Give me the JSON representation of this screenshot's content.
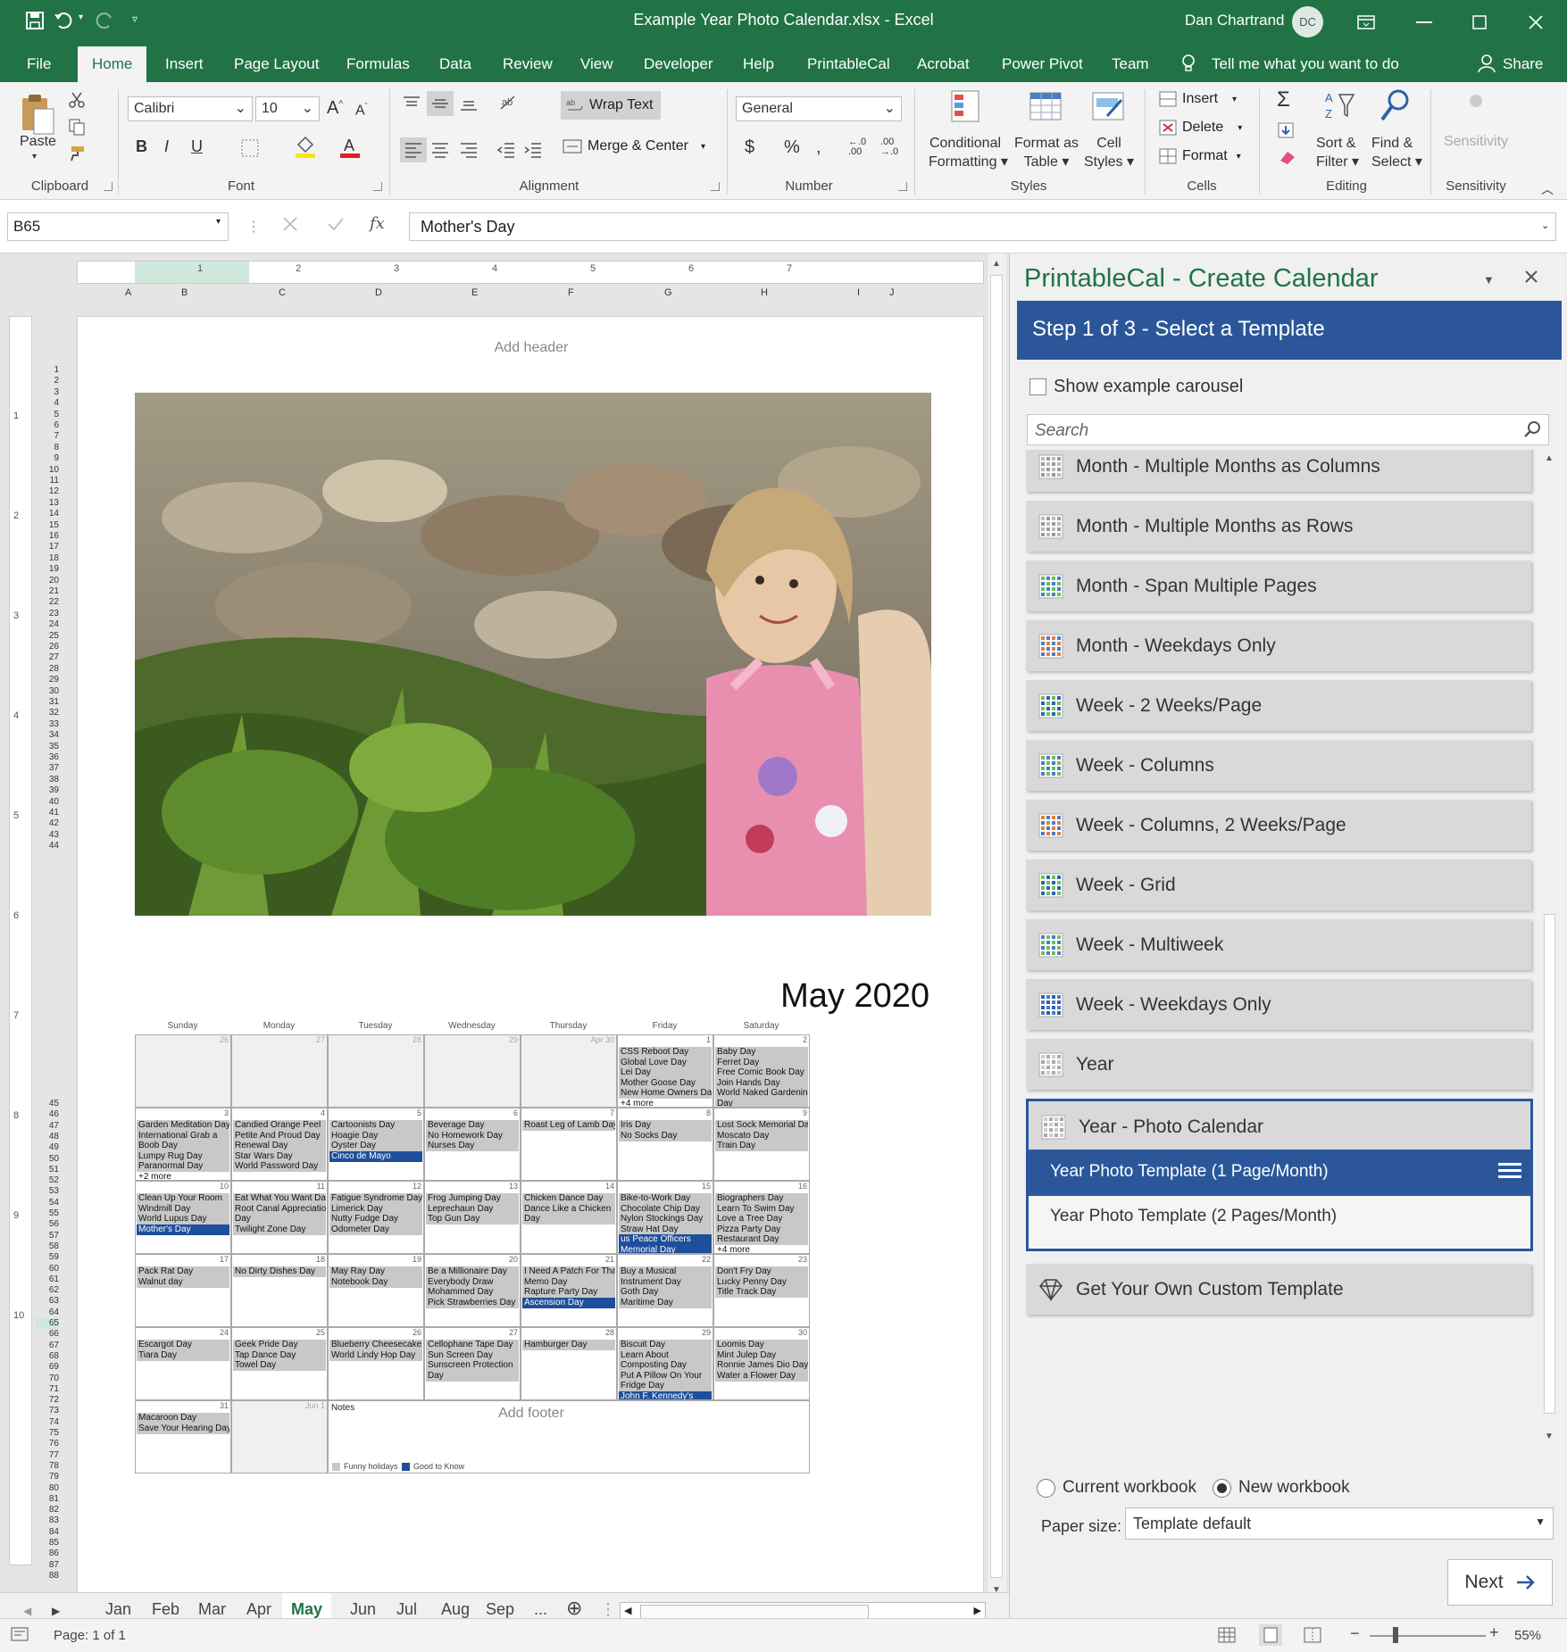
{
  "window": {
    "title": "Example Year Photo Calendar.xlsx  -  Excel",
    "user": "Dan Chartrand",
    "user_initials": "DC"
  },
  "menu": {
    "tabs": [
      "File",
      "Home",
      "Insert",
      "Page Layout",
      "Formulas",
      "Data",
      "Review",
      "View",
      "Developer",
      "Help",
      "PrintableCal",
      "Acrobat",
      "Power Pivot",
      "Team"
    ],
    "tell_me": "Tell me what you want to do",
    "share": "Share"
  },
  "ribbon": {
    "clipboard": {
      "paste": "Paste",
      "label": "Clipboard"
    },
    "font": {
      "name": "Calibri",
      "size": "10",
      "label": "Font"
    },
    "alignment": {
      "wrap": "Wrap Text",
      "merge": "Merge & Center",
      "label": "Alignment"
    },
    "number": {
      "format": "General",
      "label": "Number"
    },
    "styles": {
      "conditional": [
        "Conditional",
        "Formatting"
      ],
      "format_table": [
        "Format as",
        "Table"
      ],
      "cell_styles": [
        "Cell",
        "Styles"
      ],
      "label": "Styles"
    },
    "cells": {
      "insert": "Insert",
      "delete": "Delete",
      "format": "Format",
      "label": "Cells"
    },
    "editing": {
      "sort": [
        "Sort &",
        "Filter"
      ],
      "find": [
        "Find &",
        "Select"
      ],
      "label": "Editing"
    },
    "sensitivity": {
      "button": "Sensitivity",
      "label": "Sensitivity"
    }
  },
  "formula_bar": {
    "name_box": "B65",
    "value": "Mother's Day"
  },
  "sheet": {
    "ruler_marks": [
      "1",
      "2",
      "3",
      "4",
      "5",
      "6",
      "7"
    ],
    "columns": [
      "A",
      "B",
      "C",
      "D",
      "E",
      "F",
      "G",
      "H",
      "I",
      "J"
    ],
    "vruler_marks": [
      "1",
      "2",
      "3",
      "4",
      "5",
      "6",
      "7",
      "8",
      "9",
      "10"
    ],
    "add_header": "Add header",
    "add_footer": "Add footer",
    "month_title": "May 2020",
    "day_names": [
      "Sunday",
      "Monday",
      "Tuesday",
      "Wednesday",
      "Thursday",
      "Friday",
      "Saturday"
    ],
    "weeks": [
      [
        {
          "day": "26",
          "dim": true,
          "grey": true,
          "events": []
        },
        {
          "day": "27",
          "dim": true,
          "grey": true,
          "events": []
        },
        {
          "day": "28",
          "dim": true,
          "grey": true,
          "events": []
        },
        {
          "day": "29",
          "dim": true,
          "grey": true,
          "events": []
        },
        {
          "day": "Apr 30",
          "dim": true,
          "grey": true,
          "events": []
        },
        {
          "day": "1",
          "events": [
            {
              "t": "CSS Reboot Day"
            },
            {
              "t": "Global Love Day"
            },
            {
              "t": "Lei Day"
            },
            {
              "t": "Mother Goose Day"
            },
            {
              "t": "New Home Owners Day"
            },
            {
              "t": "+4 more",
              "k": "plain"
            }
          ]
        },
        {
          "day": "2",
          "events": [
            {
              "t": "Baby Day"
            },
            {
              "t": "Ferret Day"
            },
            {
              "t": "Free Comic Book Day"
            },
            {
              "t": "Join Hands Day"
            },
            {
              "t": "World Naked Gardening"
            },
            {
              "t": "Day"
            }
          ]
        }
      ],
      [
        {
          "day": "3",
          "events": [
            {
              "t": "Garden Meditation Day"
            },
            {
              "t": "International Grab a"
            },
            {
              "t": "Boob Day"
            },
            {
              "t": "Lumpy Rug Day"
            },
            {
              "t": "Paranormal Day"
            },
            {
              "t": "+2 more",
              "k": "plain"
            }
          ]
        },
        {
          "day": "4",
          "events": [
            {
              "t": "Candied Orange Peel"
            },
            {
              "t": "Petite And Proud Day"
            },
            {
              "t": "Renewal Day"
            },
            {
              "t": "Star Wars Day"
            },
            {
              "t": "World Password Day"
            }
          ]
        },
        {
          "day": "5",
          "events": [
            {
              "t": "Cartoonists Day"
            },
            {
              "t": "Hoagie Day"
            },
            {
              "t": "Oyster Day"
            },
            {
              "t": "Cinco de Mayo",
              "k": "blue"
            }
          ]
        },
        {
          "day": "6",
          "events": [
            {
              "t": "Beverage Day"
            },
            {
              "t": "No Homework Day"
            },
            {
              "t": "Nurses Day"
            }
          ]
        },
        {
          "day": "7",
          "events": [
            {
              "t": "Roast Leg of Lamb Day"
            }
          ]
        },
        {
          "day": "8",
          "events": [
            {
              "t": "Iris Day"
            },
            {
              "t": "No Socks Day"
            }
          ]
        },
        {
          "day": "9",
          "events": [
            {
              "t": "Lost Sock Memorial Day"
            },
            {
              "t": "Moscato Day"
            },
            {
              "t": "Train Day"
            }
          ]
        }
      ],
      [
        {
          "day": "10",
          "events": [
            {
              "t": "Clean Up Your Room"
            },
            {
              "t": "Windmill Day"
            },
            {
              "t": "World Lupus Day"
            },
            {
              "t": "Mother's Day",
              "k": "blue"
            }
          ]
        },
        {
          "day": "11",
          "events": [
            {
              "t": "Eat What You Want Day"
            },
            {
              "t": "Root Canal Appreciation"
            },
            {
              "t": "Day"
            },
            {
              "t": "Twilight Zone Day"
            }
          ]
        },
        {
          "day": "12",
          "events": [
            {
              "t": "Fatigue Syndrome Day"
            },
            {
              "t": "Limerick Day"
            },
            {
              "t": "Nutty Fudge Day"
            },
            {
              "t": "Odometer Day"
            }
          ]
        },
        {
          "day": "13",
          "events": [
            {
              "t": "Frog Jumping Day"
            },
            {
              "t": "Leprechaun Day"
            },
            {
              "t": "Top Gun Day"
            }
          ]
        },
        {
          "day": "14",
          "events": [
            {
              "t": "Chicken Dance Day"
            },
            {
              "t": "Dance Like a Chicken"
            },
            {
              "t": "Day"
            }
          ]
        },
        {
          "day": "15",
          "events": [
            {
              "t": "Bike-to-Work Day"
            },
            {
              "t": "Chocolate Chip Day"
            },
            {
              "t": "Nylon Stockings Day"
            },
            {
              "t": "Straw Hat Day"
            },
            {
              "t": "us Peace Officers",
              "k": "blue"
            },
            {
              "t": "Memorial Day",
              "k": "blue"
            }
          ]
        },
        {
          "day": "16",
          "events": [
            {
              "t": "Biographers Day"
            },
            {
              "t": "Learn To Swim Day"
            },
            {
              "t": "Love a Tree Day"
            },
            {
              "t": "Pizza Party Day"
            },
            {
              "t": "Restaurant Day"
            },
            {
              "t": "+4 more",
              "k": "plain"
            }
          ]
        }
      ],
      [
        {
          "day": "17",
          "events": [
            {
              "t": "Pack Rat Day"
            },
            {
              "t": "Walnut day"
            }
          ]
        },
        {
          "day": "18",
          "events": [
            {
              "t": "No Dirty Dishes Day"
            }
          ]
        },
        {
          "day": "19",
          "events": [
            {
              "t": "May Ray Day"
            },
            {
              "t": "Notebook Day"
            }
          ]
        },
        {
          "day": "20",
          "events": [
            {
              "t": "Be a Millionaire Day"
            },
            {
              "t": "Everybody Draw"
            },
            {
              "t": "Mohammed Day"
            },
            {
              "t": "Pick Strawberries Day"
            }
          ]
        },
        {
          "day": "21",
          "events": [
            {
              "t": "I Need A Patch For That"
            },
            {
              "t": "Memo Day"
            },
            {
              "t": "Rapture Party Day"
            },
            {
              "t": "Ascension Day",
              "k": "blue"
            }
          ]
        },
        {
          "day": "22",
          "events": [
            {
              "t": "Buy a Musical"
            },
            {
              "t": "Instrument Day"
            },
            {
              "t": "Goth Day"
            },
            {
              "t": "Maritime Day"
            }
          ]
        },
        {
          "day": "23",
          "events": [
            {
              "t": "Don't Fry Day"
            },
            {
              "t": "Lucky Penny Day"
            },
            {
              "t": "Title Track Day"
            }
          ]
        }
      ],
      [
        {
          "day": "24",
          "events": [
            {
              "t": "Escargot Day"
            },
            {
              "t": "Tiara Day"
            }
          ]
        },
        {
          "day": "25",
          "events": [
            {
              "t": "Geek Pride Day"
            },
            {
              "t": "Tap Dance Day"
            },
            {
              "t": "Towel Day"
            }
          ]
        },
        {
          "day": "26",
          "events": [
            {
              "t": "Blueberry Cheesecake"
            },
            {
              "t": "World Lindy Hop Day"
            }
          ]
        },
        {
          "day": "27",
          "events": [
            {
              "t": "Cellophane Tape Day"
            },
            {
              "t": "Sun Screen Day"
            },
            {
              "t": "Sunscreen Protection"
            },
            {
              "t": "Day"
            }
          ]
        },
        {
          "day": "28",
          "events": [
            {
              "t": "Hamburger Day"
            }
          ]
        },
        {
          "day": "29",
          "events": [
            {
              "t": "Biscuit Day"
            },
            {
              "t": "Learn About"
            },
            {
              "t": "Composting Day"
            },
            {
              "t": "Put A Pillow On Your"
            },
            {
              "t": "Fridge Day"
            },
            {
              "t": "John F. Kennedy's",
              "k": "blue"
            }
          ]
        },
        {
          "day": "30",
          "events": [
            {
              "t": "Loomis Day"
            },
            {
              "t": "Mint Julep Day"
            },
            {
              "t": "Ronnie James Dio Day"
            },
            {
              "t": "Water a Flower Day"
            }
          ]
        }
      ]
    ],
    "last_row": [
      {
        "day": "31",
        "events": [
          {
            "t": "Macaroon Day"
          },
          {
            "t": "Save Your Hearing Day"
          }
        ]
      },
      {
        "day": "Jun 1",
        "dim": true,
        "grey": true,
        "events": []
      }
    ],
    "notes_label": "Notes",
    "legend": [
      {
        "label": "Funny holidays",
        "color": "#c8c8c8"
      },
      {
        "label": "Good to Know",
        "color": "#1e4f9a"
      }
    ],
    "tabs": [
      "Jan",
      "Feb",
      "Mar",
      "Apr",
      "May",
      "Jun",
      "Jul",
      "Aug",
      "Sep",
      "..."
    ],
    "active_tab": "May"
  },
  "pane": {
    "title": "PrintableCal - Create Calendar",
    "step": "Step 1 of 3 - Select a Template",
    "show_carousel": "Show example carousel",
    "search_placeholder": "Search",
    "templates": [
      "Month - Multiple Months as Columns",
      "Month - Multiple Months as Rows",
      "Month - Span Multiple Pages",
      "Month - Weekdays Only",
      "Week - 2 Weeks/Page",
      "Week - Columns",
      "Week - Columns, 2 Weeks/Page",
      "Week - Grid",
      "Week - Multiweek",
      "Week - Weekdays Only",
      "Year"
    ],
    "selected_template": "Year - Photo Calendar",
    "sub_templates": [
      "Year Photo Template (1 Page/Month)",
      "Year Photo Template (2 Pages/Month)"
    ],
    "custom": "Get Your Own Custom Template",
    "workbook_options": [
      "Current workbook",
      "New workbook"
    ],
    "paper_size_label": "Paper size:",
    "paper_size_value": "Template default",
    "next": "Next"
  },
  "status": {
    "page": "Page: 1 of 1",
    "zoom": "55%"
  },
  "colors": {
    "excel_green": "#217346",
    "accent_blue": "#2b579a"
  }
}
